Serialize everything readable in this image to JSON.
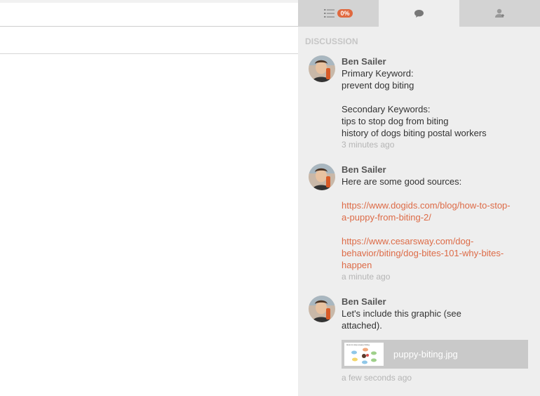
{
  "tabs": [
    {
      "icon": "checklist-icon",
      "badge": "0%"
    },
    {
      "icon": "chat-bubble-icon"
    },
    {
      "icon": "user-add-icon"
    }
  ],
  "discussion": {
    "title": "DISCUSSION",
    "messages": [
      {
        "author": "Ben Sailer",
        "lines": [
          "Primary Keyword:",
          "prevent dog biting",
          "",
          "Secondary Keywords:",
          "tips to stop dog from biting",
          "history of dogs biting postal workers"
        ],
        "time": "3 minutes ago"
      },
      {
        "author": "Ben Sailer",
        "lines": [
          "Here are some good sources:"
        ],
        "links": [
          [
            "https://www.dogids.com/blog/how-to-stop-",
            "a-puppy-from-biting-2/"
          ],
          [
            "https://www.cesarsway.com/dog-",
            "behavior/biting/dog-bites-101-why-bites-",
            "happen"
          ]
        ],
        "time": "a minute ago"
      },
      {
        "author": "Ben Sailer",
        "lines": [
          "Let's include this graphic (see",
          "attached)."
        ],
        "attachment": {
          "filename": "puppy-biting.jpg",
          "thumb_title": "How to stop puppy biting"
        },
        "time": "a few seconds ago"
      }
    ]
  },
  "colors": {
    "accent": "#e0693f",
    "link": "#dd6b47",
    "panel_bg": "#eeeeee",
    "tab_bg": "#d3d3d3"
  }
}
